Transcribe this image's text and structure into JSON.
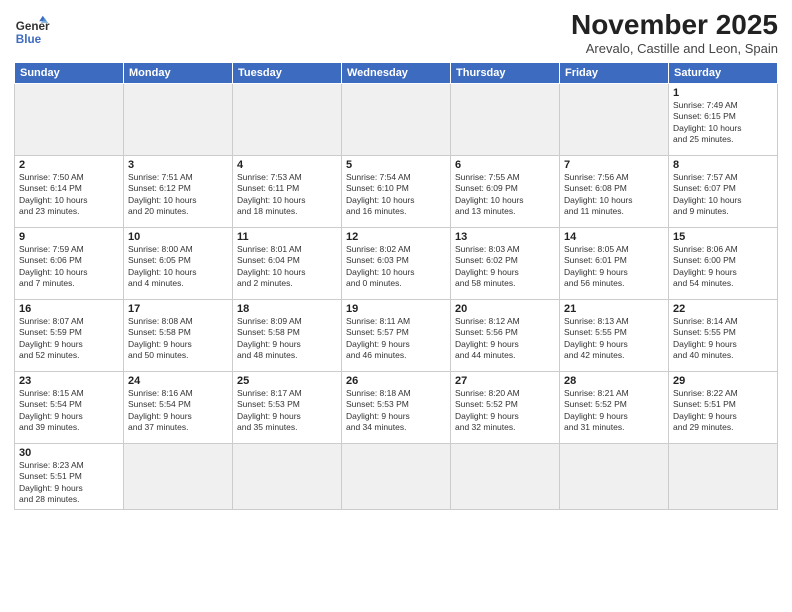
{
  "logo": {
    "line1": "General",
    "line2": "Blue"
  },
  "title": "November 2025",
  "subtitle": "Arevalo, Castille and Leon, Spain",
  "days_header": [
    "Sunday",
    "Monday",
    "Tuesday",
    "Wednesday",
    "Thursday",
    "Friday",
    "Saturday"
  ],
  "weeks": [
    [
      {
        "day": "",
        "info": ""
      },
      {
        "day": "",
        "info": ""
      },
      {
        "day": "",
        "info": ""
      },
      {
        "day": "",
        "info": ""
      },
      {
        "day": "",
        "info": ""
      },
      {
        "day": "",
        "info": ""
      },
      {
        "day": "1",
        "info": "Sunrise: 7:49 AM\nSunset: 6:15 PM\nDaylight: 10 hours\nand 25 minutes."
      }
    ],
    [
      {
        "day": "2",
        "info": "Sunrise: 7:50 AM\nSunset: 6:14 PM\nDaylight: 10 hours\nand 23 minutes."
      },
      {
        "day": "3",
        "info": "Sunrise: 7:51 AM\nSunset: 6:12 PM\nDaylight: 10 hours\nand 20 minutes."
      },
      {
        "day": "4",
        "info": "Sunrise: 7:53 AM\nSunset: 6:11 PM\nDaylight: 10 hours\nand 18 minutes."
      },
      {
        "day": "5",
        "info": "Sunrise: 7:54 AM\nSunset: 6:10 PM\nDaylight: 10 hours\nand 16 minutes."
      },
      {
        "day": "6",
        "info": "Sunrise: 7:55 AM\nSunset: 6:09 PM\nDaylight: 10 hours\nand 13 minutes."
      },
      {
        "day": "7",
        "info": "Sunrise: 7:56 AM\nSunset: 6:08 PM\nDaylight: 10 hours\nand 11 minutes."
      },
      {
        "day": "8",
        "info": "Sunrise: 7:57 AM\nSunset: 6:07 PM\nDaylight: 10 hours\nand 9 minutes."
      }
    ],
    [
      {
        "day": "9",
        "info": "Sunrise: 7:59 AM\nSunset: 6:06 PM\nDaylight: 10 hours\nand 7 minutes."
      },
      {
        "day": "10",
        "info": "Sunrise: 8:00 AM\nSunset: 6:05 PM\nDaylight: 10 hours\nand 4 minutes."
      },
      {
        "day": "11",
        "info": "Sunrise: 8:01 AM\nSunset: 6:04 PM\nDaylight: 10 hours\nand 2 minutes."
      },
      {
        "day": "12",
        "info": "Sunrise: 8:02 AM\nSunset: 6:03 PM\nDaylight: 10 hours\nand 0 minutes."
      },
      {
        "day": "13",
        "info": "Sunrise: 8:03 AM\nSunset: 6:02 PM\nDaylight: 9 hours\nand 58 minutes."
      },
      {
        "day": "14",
        "info": "Sunrise: 8:05 AM\nSunset: 6:01 PM\nDaylight: 9 hours\nand 56 minutes."
      },
      {
        "day": "15",
        "info": "Sunrise: 8:06 AM\nSunset: 6:00 PM\nDaylight: 9 hours\nand 54 minutes."
      }
    ],
    [
      {
        "day": "16",
        "info": "Sunrise: 8:07 AM\nSunset: 5:59 PM\nDaylight: 9 hours\nand 52 minutes."
      },
      {
        "day": "17",
        "info": "Sunrise: 8:08 AM\nSunset: 5:58 PM\nDaylight: 9 hours\nand 50 minutes."
      },
      {
        "day": "18",
        "info": "Sunrise: 8:09 AM\nSunset: 5:58 PM\nDaylight: 9 hours\nand 48 minutes."
      },
      {
        "day": "19",
        "info": "Sunrise: 8:11 AM\nSunset: 5:57 PM\nDaylight: 9 hours\nand 46 minutes."
      },
      {
        "day": "20",
        "info": "Sunrise: 8:12 AM\nSunset: 5:56 PM\nDaylight: 9 hours\nand 44 minutes."
      },
      {
        "day": "21",
        "info": "Sunrise: 8:13 AM\nSunset: 5:55 PM\nDaylight: 9 hours\nand 42 minutes."
      },
      {
        "day": "22",
        "info": "Sunrise: 8:14 AM\nSunset: 5:55 PM\nDaylight: 9 hours\nand 40 minutes."
      }
    ],
    [
      {
        "day": "23",
        "info": "Sunrise: 8:15 AM\nSunset: 5:54 PM\nDaylight: 9 hours\nand 39 minutes."
      },
      {
        "day": "24",
        "info": "Sunrise: 8:16 AM\nSunset: 5:54 PM\nDaylight: 9 hours\nand 37 minutes."
      },
      {
        "day": "25",
        "info": "Sunrise: 8:17 AM\nSunset: 5:53 PM\nDaylight: 9 hours\nand 35 minutes."
      },
      {
        "day": "26",
        "info": "Sunrise: 8:18 AM\nSunset: 5:53 PM\nDaylight: 9 hours\nand 34 minutes."
      },
      {
        "day": "27",
        "info": "Sunrise: 8:20 AM\nSunset: 5:52 PM\nDaylight: 9 hours\nand 32 minutes."
      },
      {
        "day": "28",
        "info": "Sunrise: 8:21 AM\nSunset: 5:52 PM\nDaylight: 9 hours\nand 31 minutes."
      },
      {
        "day": "29",
        "info": "Sunrise: 8:22 AM\nSunset: 5:51 PM\nDaylight: 9 hours\nand 29 minutes."
      }
    ],
    [
      {
        "day": "30",
        "info": "Sunrise: 8:23 AM\nSunset: 5:51 PM\nDaylight: 9 hours\nand 28 minutes."
      },
      {
        "day": "",
        "info": ""
      },
      {
        "day": "",
        "info": ""
      },
      {
        "day": "",
        "info": ""
      },
      {
        "day": "",
        "info": ""
      },
      {
        "day": "",
        "info": ""
      },
      {
        "day": "",
        "info": ""
      }
    ]
  ]
}
